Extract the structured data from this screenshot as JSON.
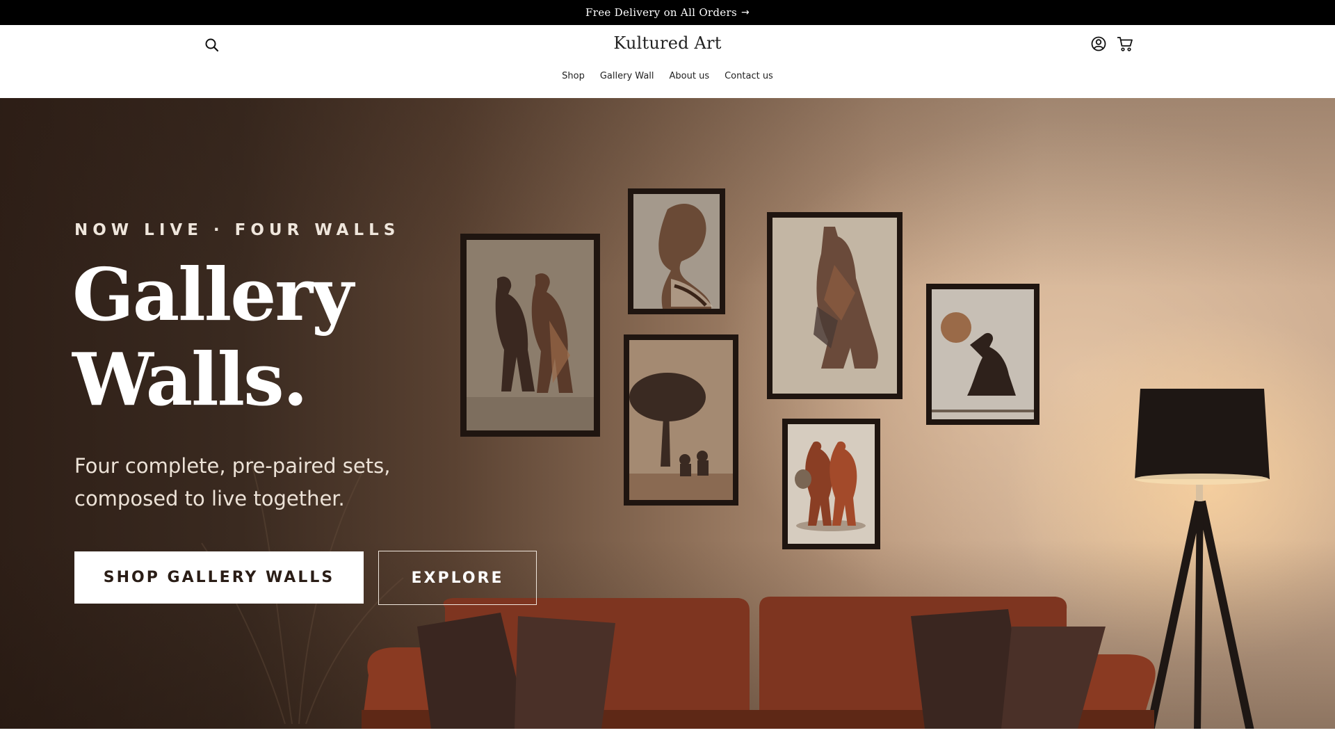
{
  "announcement": {
    "text": "Free Delivery on All Orders",
    "arrow": "→"
  },
  "header": {
    "logo": "Kultured Art",
    "icons": {
      "search": "search-icon",
      "account": "account-icon",
      "cart": "cart-icon"
    },
    "nav": [
      {
        "label": "Shop"
      },
      {
        "label": "Gallery Wall"
      },
      {
        "label": "About us"
      },
      {
        "label": "Contact us"
      }
    ]
  },
  "hero": {
    "eyebrow": "NOW LIVE · FOUR WALLS",
    "title_line1": "Gallery",
    "title_line2": "Walls.",
    "subtitle_line1": "Four complete, pre-paired sets,",
    "subtitle_line2": "composed to live together.",
    "primary_button": "SHOP GALLERY WALLS",
    "secondary_button": "EXPLORE"
  },
  "colors": {
    "announcement_bg": "#000000",
    "hero_dark": "#2e1f17",
    "hero_light": "#c9a98e",
    "sofa": "#8a3a22",
    "frame": "#1f1510"
  }
}
